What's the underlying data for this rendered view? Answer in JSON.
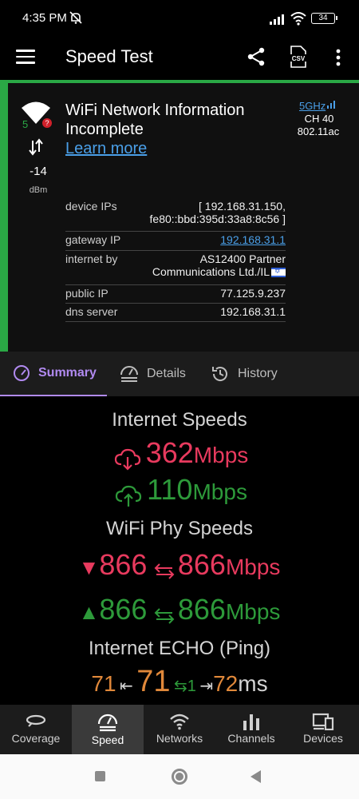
{
  "status_bar": {
    "time": "4:35 PM",
    "battery": "34"
  },
  "app_bar": {
    "title": "Speed Test"
  },
  "network": {
    "title": "WiFi Network Information Incomplete",
    "learn_more": "Learn more",
    "signal_level": "5",
    "rssi": "-14",
    "rssi_unit": "dBm",
    "band": "5GHz",
    "channel": "CH 40",
    "standard": "802.11ac",
    "info": {
      "device_ips_label": "device IPs",
      "device_ips_value_1": "[ 192.168.31.150,",
      "device_ips_value_2": "fe80::bbd:395d:33a8:8c56 ]",
      "gateway_label": "gateway IP",
      "gateway_value": "192.168.31.1",
      "internet_by_label": "internet by",
      "internet_by_value_1": "AS12400 Partner",
      "internet_by_value_2": "Communications Ltd./IL",
      "public_ip_label": "public IP",
      "public_ip_value": "77.125.9.237",
      "dns_label": "dns server",
      "dns_value": "192.168.31.1"
    }
  },
  "tabs": [
    {
      "label": "Summary",
      "active": true
    },
    {
      "label": "Details",
      "active": false
    },
    {
      "label": "History",
      "active": false
    }
  ],
  "summary": {
    "internet_title": "Internet Speeds",
    "download": {
      "value": "362",
      "unit": "Mbps"
    },
    "upload": {
      "value": "110",
      "unit": "Mbps"
    },
    "phy_title": "WiFi Phy Speeds",
    "phy_down": {
      "value_a": "866",
      "value_b": "866",
      "unit": "Mbps"
    },
    "phy_up": {
      "value_a": "866",
      "value_b": "866",
      "unit": "Mbps"
    },
    "ping_title": "Internet ECHO (Ping)",
    "ping": {
      "min": "71",
      "avg": "71",
      "jitter": "1",
      "max": "72",
      "unit": "ms"
    }
  },
  "bottom_nav": [
    {
      "label": "Coverage",
      "icon": "coverage-icon",
      "active": false
    },
    {
      "label": "Speed",
      "icon": "speedometer-icon",
      "active": true
    },
    {
      "label": "Networks",
      "icon": "wifi-icon",
      "active": false
    },
    {
      "label": "Channels",
      "icon": "bar-chart-icon",
      "active": false
    },
    {
      "label": "Devices",
      "icon": "devices-icon",
      "active": false
    }
  ],
  "colors": {
    "accent": "#b18af0",
    "download": "#e83a5e",
    "upload": "#2d9a3a",
    "ping": "#e0883a",
    "link": "#4a9fe8",
    "good": "#2aa845"
  }
}
